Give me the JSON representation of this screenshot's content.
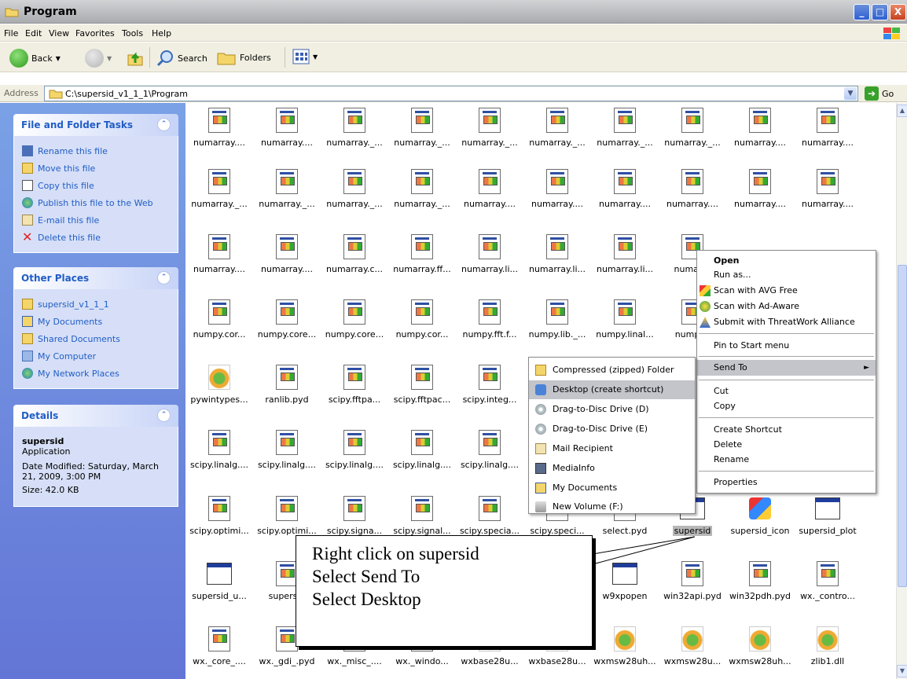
{
  "window": {
    "title": "Program",
    "minimize": "_",
    "maximize": "□",
    "close": "X"
  },
  "menu": [
    "File",
    "Edit",
    "View",
    "Favorites",
    "Tools",
    "Help"
  ],
  "toolbar": {
    "back": "Back",
    "search": "Search",
    "folders": "Folders"
  },
  "address": {
    "label": "Address",
    "value": "C:\\supersid_v1_1_1\\Program",
    "go": "Go"
  },
  "file_tasks": {
    "title": "File and Folder Tasks",
    "items": [
      "Rename this file",
      "Move this file",
      "Copy this file",
      "Publish this file to the Web",
      "E-mail this file",
      "Delete this file"
    ]
  },
  "other_places": {
    "title": "Other Places",
    "items": [
      "supersid_v1_1_1",
      "My Documents",
      "Shared Documents",
      "My Computer",
      "My Network Places"
    ]
  },
  "details": {
    "title": "Details",
    "name": "supersid",
    "type": "Application",
    "modified": "Date Modified: Saturday, March 21, 2009, 3:00 PM",
    "size": "Size: 42.0 KB"
  },
  "files": {
    "rows": [
      [
        "numarray....",
        "numarray....",
        "numarray._...",
        "numarray._...",
        "numarray._...",
        "numarray._...",
        "numarray._...",
        "numarray._...",
        "numarray....",
        "numarray...."
      ],
      [
        "numarray._...",
        "numarray._...",
        "numarray._...",
        "numarray._...",
        "numarray....",
        "numarray....",
        "numarray....",
        "numarray....",
        "numarray....",
        "numarray...."
      ],
      [
        "numarray....",
        "numarray....",
        "numarray.c...",
        "numarray.ff...",
        "numarray.li...",
        "numarray.li...",
        "numarray.li...",
        "numarra"
      ],
      [
        "numpy.cor...",
        "numpy.core...",
        "numpy.core...",
        "numpy.cor...",
        "numpy.fft.f...",
        "numpy.lib._...",
        "numpy.linal...",
        "numpy.r"
      ],
      [
        "pywintypes...",
        "ranlib.pyd",
        "scipy.fftpa...",
        "scipy.fftpac...",
        "scipy.integ..."
      ],
      [
        "scipy.linalg....",
        "scipy.linalg....",
        "scipy.linalg....",
        "scipy.linalg....",
        "scipy.linalg...."
      ],
      [
        "scipy.optimi...",
        "scipy.optimi...",
        "scipy.signa...",
        "scipy.signal...",
        "scipy.specia...",
        "scipy.speci...",
        "select.pyd",
        "supersid",
        "supersid_icon",
        "supersid_plot"
      ],
      [
        "supersid_u...",
        "supersid",
        "",
        "",
        "",
        "",
        "w9xpopen",
        "win32api.pyd",
        "win32pdh.pyd",
        "wx._contro..."
      ],
      [
        "wx._core_....",
        "wx._gdi_.pyd",
        "wx._misc_....",
        "wx._windo...",
        "wxbase28u...",
        "wxbase28u...",
        "wxmsw28uh...",
        "wxmsw28u...",
        "wxmsw28uh...",
        "zlib1.dll"
      ]
    ]
  },
  "context_menu": {
    "items": [
      "Open",
      "Run as...",
      "Scan with AVG Free",
      "Scan with Ad-Aware",
      "Submit with ThreatWork Alliance",
      "Pin to Start menu",
      "Send To",
      "Cut",
      "Copy",
      "Create Shortcut",
      "Delete",
      "Rename",
      "Properties"
    ],
    "arrow": "►"
  },
  "send_to": {
    "items": [
      "Compressed (zipped) Folder",
      "Desktop (create shortcut)",
      "Drag-to-Disc Drive (D)",
      "Drag-to-Disc Drive (E)",
      "Mail Recipient",
      "MediaInfo",
      "My Documents",
      "New Volume (F:)"
    ]
  },
  "callout": {
    "lines": [
      "Right click on supersid",
      "Select Send To",
      "Select Desktop"
    ]
  },
  "colors": {
    "xp_blue": "#215dc6",
    "pane_top": "#7aa1e6",
    "pane_bottom": "#6375d6",
    "menu_highlight": "#c3c5cb"
  }
}
